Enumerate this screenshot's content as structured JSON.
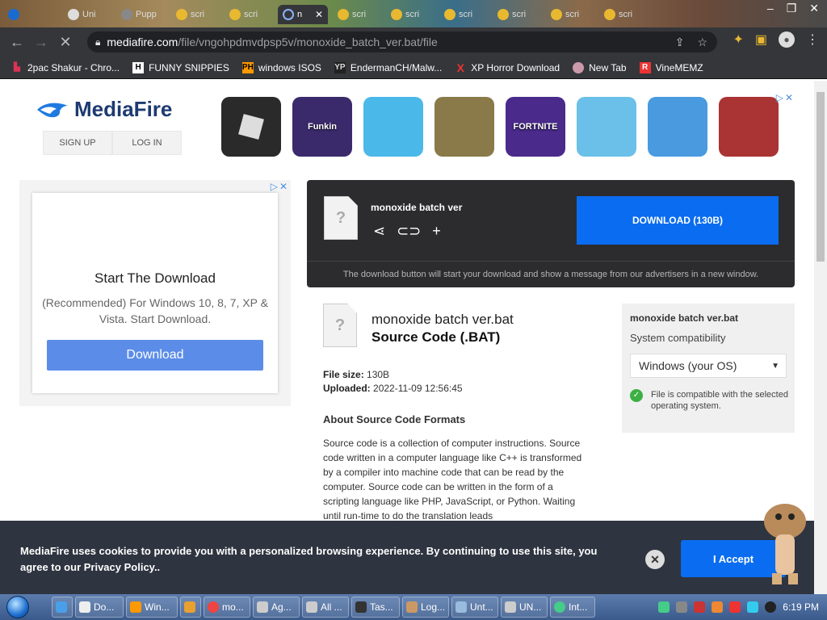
{
  "browser": {
    "tabs": [
      {
        "label": ""
      },
      {
        "label": "Uni"
      },
      {
        "label": "Pupp"
      },
      {
        "label": "scri"
      },
      {
        "label": "scri"
      },
      {
        "label": "n",
        "active": true
      },
      {
        "label": "scri"
      },
      {
        "label": "scri"
      },
      {
        "label": "scri"
      },
      {
        "label": "scri"
      },
      {
        "label": "scri"
      },
      {
        "label": "scri"
      }
    ],
    "url_host": "mediafire.com",
    "url_path": "/file/vngohpdmvdpsp5v/monoxide_batch_ver.bat/file",
    "bookmarks": [
      {
        "label": "2pac Shakur - Chro...",
        "icon": "bookmark-icon",
        "color": "#d35"
      },
      {
        "label": "FUNNY SNIPPIES",
        "icon": "H",
        "color": "#fff"
      },
      {
        "label": "windows ISOS",
        "icon": "PH",
        "color": "#f90"
      },
      {
        "label": "EndermanCH/Malw...",
        "icon": "YP",
        "color": "#ddd"
      },
      {
        "label": "XP Horror Download",
        "icon": "X",
        "color": "#e33"
      },
      {
        "label": "New Tab",
        "icon": "globe-icon",
        "color": "#c9a"
      },
      {
        "label": "VineMEMZ",
        "icon": "R",
        "color": "#e33"
      }
    ]
  },
  "header": {
    "logo_text": "MediaFire",
    "sign_up": "SIGN UP",
    "log_in": "LOG IN",
    "ad_tiles": [
      {
        "label": "",
        "color": "#222"
      },
      {
        "label": "Funkin",
        "color": "#3b2a6b"
      },
      {
        "label": "",
        "color": "#4ab8e8"
      },
      {
        "label": "",
        "color": "#8a7a4a"
      },
      {
        "label": "FORTNITE",
        "color": "#4a2a8a"
      },
      {
        "label": "",
        "color": "#6ac0e8"
      },
      {
        "label": "",
        "color": "#4a9ae0"
      },
      {
        "label": "",
        "color": "#a33"
      }
    ]
  },
  "left_ad": {
    "title": "Start The Download",
    "text": "(Recommended) For Windows 10, 8, 7, XP & Vista. Start Download.",
    "button": "Download"
  },
  "download": {
    "file_name": "monoxide batch ver",
    "button": "DOWNLOAD (130B)",
    "note": "The download button will start your download and show a message from our advertisers in a new window."
  },
  "file": {
    "full_name": "monoxide batch ver.bat",
    "type": "Source Code (.BAT)",
    "size_label": "File size:",
    "size": "130B",
    "uploaded_label": "Uploaded:",
    "uploaded": "2022-11-09 12:56:45",
    "about_title": "About Source Code Formats",
    "about_text": "Source code is a collection of computer instructions. Source code written in a computer language like C++ is transformed by a compiler into machine code that can be read by the computer. Source code can be written in the form of a scripting language like PHP, JavaScript, or Python. Waiting until run-time to do the translation leads"
  },
  "compat": {
    "title": "monoxide batch ver.bat",
    "subtitle": "System compatibility",
    "selected": "Windows (your OS)",
    "status": "File is compatible with the selected operating system."
  },
  "cookie": {
    "message": "MediaFire uses cookies to provide you with a personalized browsing experience. By continuing to use this site, you agree to our Privacy Policy..",
    "accept": "I Accept"
  },
  "taskbar": {
    "items": [
      {
        "label": "",
        "color": "#4aa0e8"
      },
      {
        "label": "Do...",
        "color": "#eee"
      },
      {
        "label": "Win...",
        "color": "#f90"
      },
      {
        "label": "",
        "color": "#e8a030"
      },
      {
        "label": "mo...",
        "color": "#e44"
      },
      {
        "label": "Ag...",
        "color": "#ccc"
      },
      {
        "label": "All ...",
        "color": "#ccc"
      },
      {
        "label": "Tas...",
        "color": "#333"
      },
      {
        "label": "Log...",
        "color": "#c96"
      },
      {
        "label": "Unt...",
        "color": "#9bd"
      },
      {
        "label": "UN...",
        "color": "#ccc"
      },
      {
        "label": "Int...",
        "color": "#4c8"
      }
    ],
    "time": "6:19 PM"
  }
}
